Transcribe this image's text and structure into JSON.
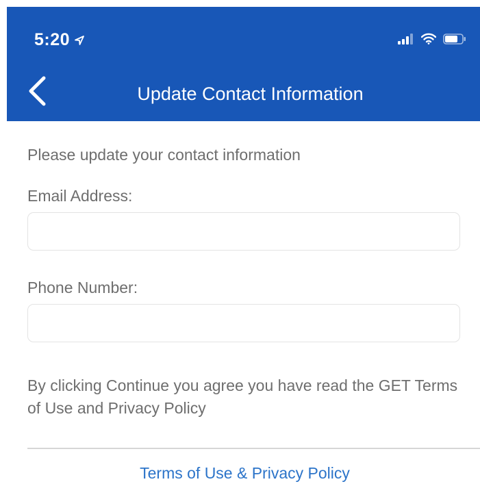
{
  "status_bar": {
    "time": "5:20",
    "location_icon": "location-arrow-icon",
    "signal_icon": "cellular-signal-icon",
    "wifi_icon": "wifi-icon",
    "battery_icon": "battery-icon"
  },
  "header": {
    "title": "Update Contact Information",
    "back_icon": "chevron-left-icon",
    "background_color": "#1857b7"
  },
  "form": {
    "intro": "Please update your contact information",
    "email_label": "Email Address:",
    "email_value": "",
    "phone_label": "Phone Number:",
    "phone_value": "",
    "consent_text": "By clicking Continue you agree you have read the GET Terms of Use and Privacy Policy"
  },
  "footer": {
    "terms_link": "Terms of Use & Privacy Policy",
    "link_color": "#2c74c9"
  }
}
